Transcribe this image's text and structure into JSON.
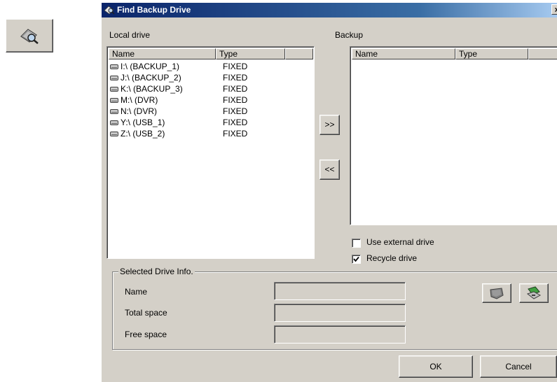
{
  "dialog": {
    "title": "Find Backup Drive",
    "close_glyph": "×"
  },
  "local": {
    "label": "Local drive",
    "headers": [
      "Name",
      "Type",
      ""
    ],
    "drives": [
      {
        "name": "I:\\ (BACKUP_1)",
        "type": "FIXED"
      },
      {
        "name": "J:\\ (BACKUP_2)",
        "type": "FIXED"
      },
      {
        "name": "K:\\ (BACKUP_3)",
        "type": "FIXED"
      },
      {
        "name": "M:\\ (DVR)",
        "type": "FIXED"
      },
      {
        "name": "N:\\ (DVR)",
        "type": "FIXED"
      },
      {
        "name": "Y:\\ (USB_1)",
        "type": "FIXED"
      },
      {
        "name": "Z:\\ (USB_2)",
        "type": "FIXED"
      }
    ]
  },
  "backup": {
    "label": "Backup",
    "headers": [
      "Name",
      "Type",
      ""
    ]
  },
  "transfer": {
    "add_label": ">>",
    "remove_label": "<<"
  },
  "options": {
    "use_external_label": "Use external drive",
    "use_external_checked": false,
    "recycle_label": "Recycle drive",
    "recycle_checked": true
  },
  "info": {
    "caption": "Selected Drive Info.",
    "name_label": "Name",
    "total_label": "Total space",
    "free_label": "Free space",
    "name_value": "",
    "total_value": "",
    "free_value": ""
  },
  "footer": {
    "ok_label": "OK",
    "cancel_label": "Cancel"
  },
  "icons": {
    "launcher": "find-drive-icon",
    "eject": "eject-drive-icon",
    "format": "format-drive-icon"
  }
}
